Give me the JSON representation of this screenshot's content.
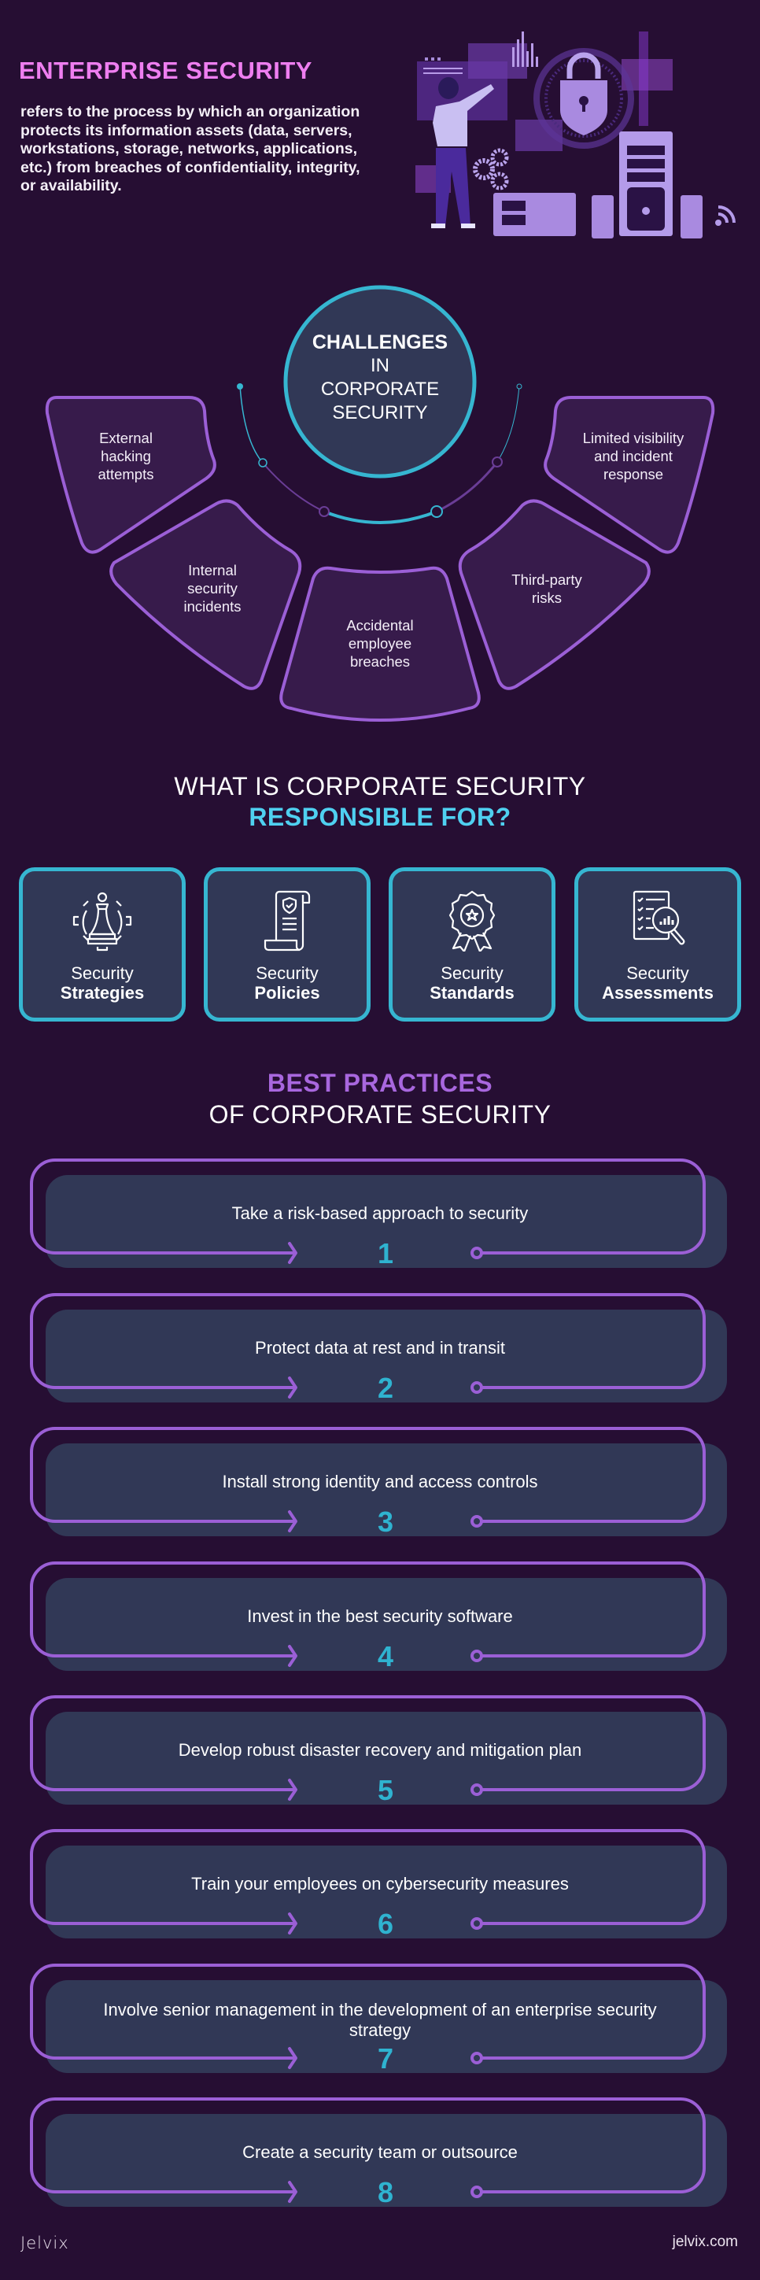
{
  "header": {
    "title": "ENTERPRISE SECURITY",
    "description": "refers to the process by which an organization protects its information assets (data, servers, workstations, storage, networks, applications, etc.) from breaches of confidentiality, integrity, or availability."
  },
  "challenges": {
    "title_bold": "CHALLENGES",
    "title_line2": "IN",
    "title_line3": "CORPORATE",
    "title_line4": "SECURITY",
    "items": [
      {
        "label": "External hacking attempts",
        "lines": [
          "External",
          "hacking",
          "attempts"
        ]
      },
      {
        "label": "Internal security incidents",
        "lines": [
          "Internal",
          "security",
          "incidents"
        ]
      },
      {
        "label": "Accidental employee breaches",
        "lines": [
          "Accidental",
          "employee",
          "breaches"
        ]
      },
      {
        "label": "Third-party risks",
        "lines": [
          "Third-party",
          "risks"
        ]
      },
      {
        "label": "Limited visibility and incident response",
        "lines": [
          "Limited visibility",
          "and incident",
          "response"
        ]
      }
    ]
  },
  "responsibilities": {
    "heading_line1": "WHAT IS CORPORATE SECURITY",
    "heading_line2": "RESPONSIBLE FOR?",
    "cards": [
      {
        "line1": "Security",
        "line2": "Strategies",
        "icon": "chess-gear-icon"
      },
      {
        "line1": "Security",
        "line2": "Policies",
        "icon": "policy-scroll-icon"
      },
      {
        "line1": "Security",
        "line2": "Standards",
        "icon": "award-badge-icon"
      },
      {
        "line1": "Security",
        "line2": "Assessments",
        "icon": "checklist-magnifier-icon"
      }
    ]
  },
  "practices": {
    "heading_line1": "BEST PRACTICES",
    "heading_line2": "OF CORPORATE SECURITY",
    "items": [
      {
        "number": "1",
        "text": "Take a risk-based approach to security"
      },
      {
        "number": "2",
        "text": "Protect data at rest and in transit"
      },
      {
        "number": "3",
        "text": "Install strong identity and access controls"
      },
      {
        "number": "4",
        "text": "Invest in the best security software"
      },
      {
        "number": "5",
        "text": "Develop robust disaster recovery and mitigation plan"
      },
      {
        "number": "6",
        "text": "Train your employees on cybersecurity measures"
      },
      {
        "number": "7",
        "text": "Involve senior management in the development of an enterprise security strategy"
      },
      {
        "number": "8",
        "text": "Create a security team or outsource"
      }
    ]
  },
  "footer": {
    "brand": "Jelvix",
    "url": "jelvix.com"
  },
  "colors": {
    "background": "#260e33",
    "title_pink": "#ee7ef0",
    "accent_purple": "#9b5fd6",
    "accent_cyan": "#36b6d1",
    "card_fill": "#313856",
    "shape_fill": "#371b4b",
    "heading_cyan": "#4fd0f0",
    "heading_purple": "#a867de"
  }
}
